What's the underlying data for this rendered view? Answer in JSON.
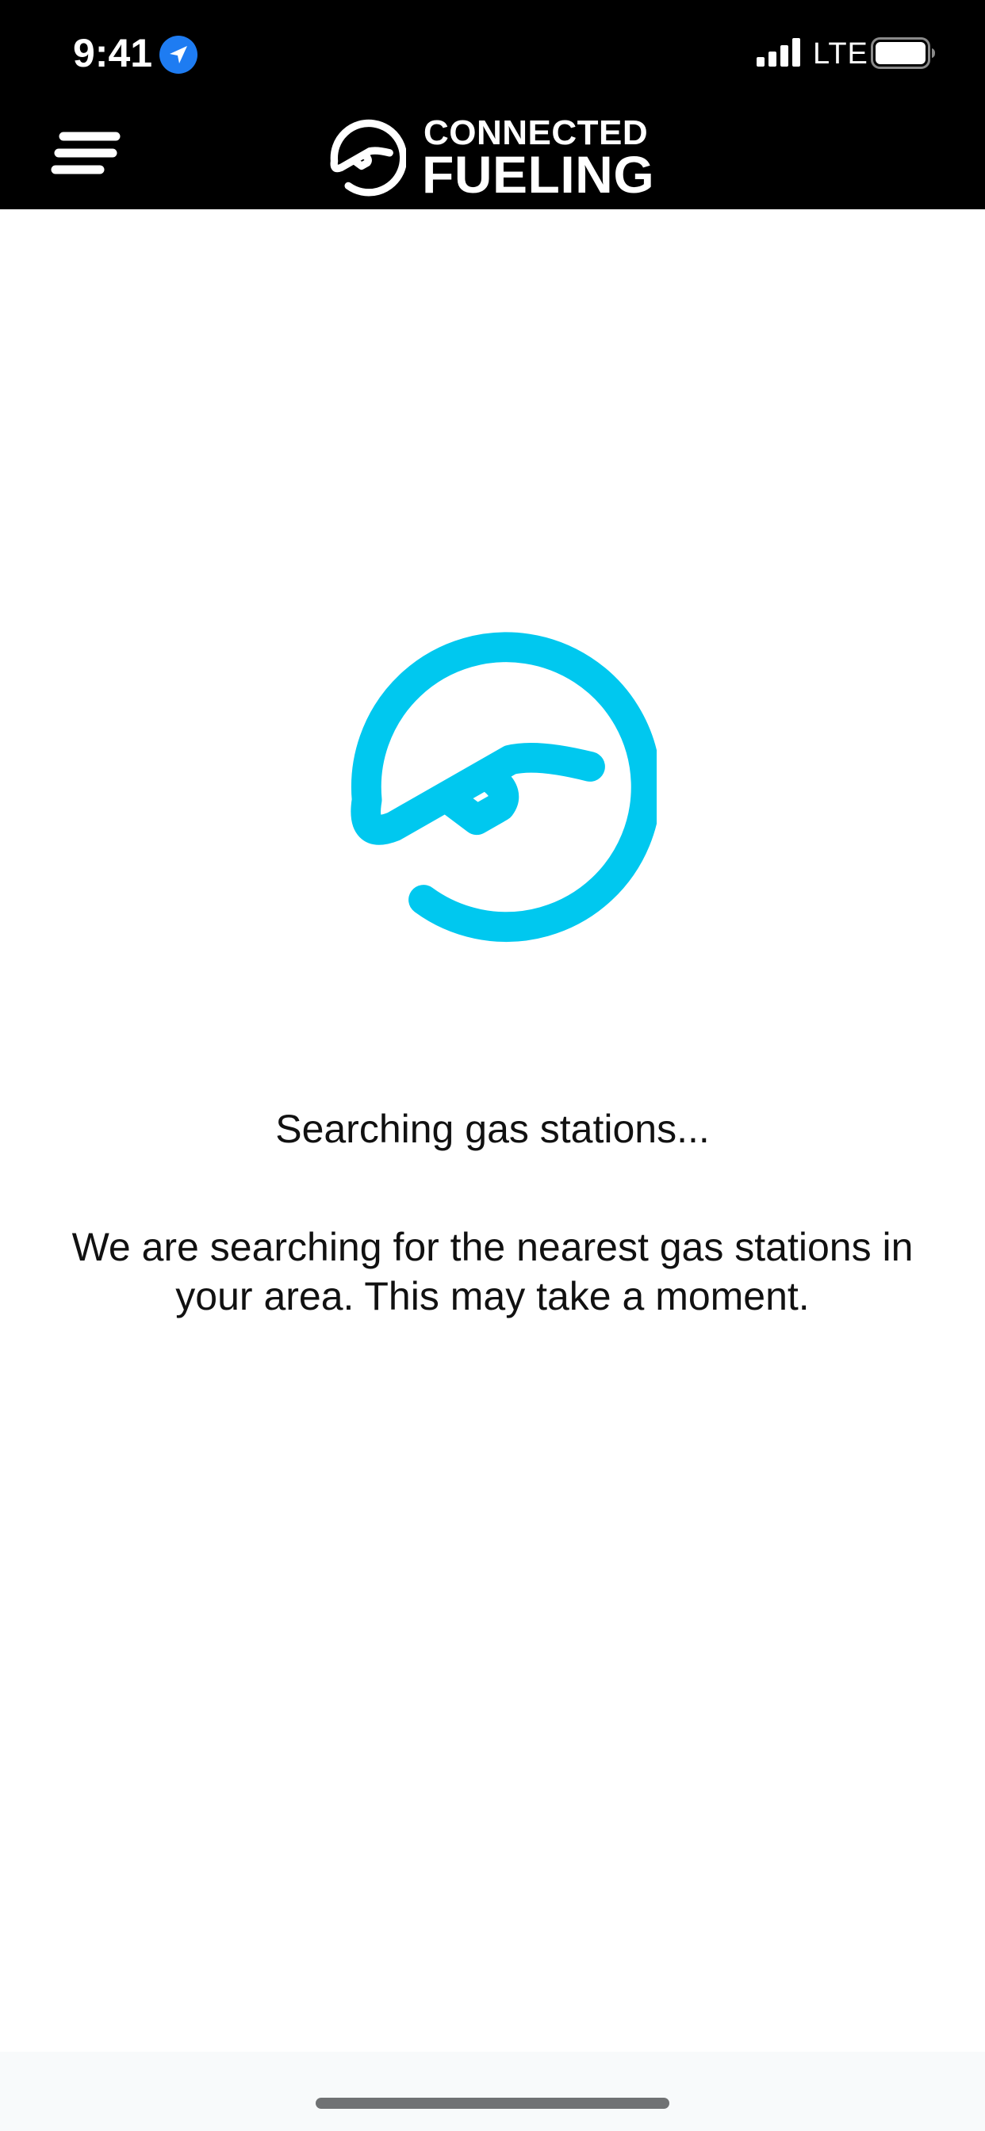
{
  "status_bar": {
    "time": "9:41",
    "network": "LTE",
    "location_icon": "location-arrow-icon",
    "signal_icon": "cellular-signal-icon",
    "battery_icon": "battery-full-icon"
  },
  "header": {
    "menu_icon": "hamburger-menu-icon",
    "brand_line1": "CONNECTED",
    "brand_line2": "FUELING",
    "brand_logo_icon": "connected-fueling-logo-icon"
  },
  "main": {
    "loader_icon": "connected-fueling-logo-icon",
    "title": "Searching gas stations...",
    "message": "We are searching for the nearest gas stations in your area. This may take a moment."
  },
  "colors": {
    "header_background": "#000000",
    "accent": "#00C8EF",
    "location_badge": "#1E7CF2",
    "text": "#111111",
    "page_background": "#FFFFFF"
  }
}
